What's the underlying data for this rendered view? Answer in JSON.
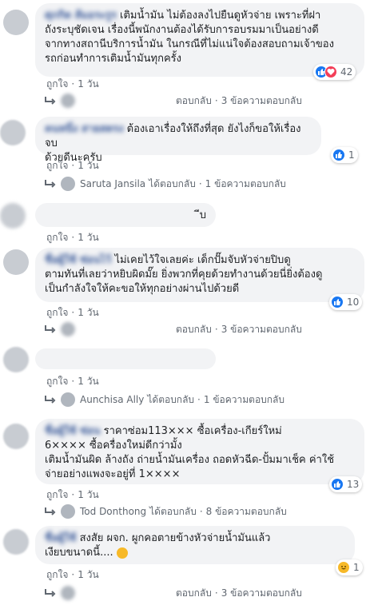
{
  "comments": [
    {
      "author": "ศุภกิต ส้มอระรูร",
      "text": "เติมน้ำมัน ไม่ต้องลงไปยืนดูหัวจ่าย เพราะที่ฝาถังระบุชัดเจน เรื่องนี้พนักงานต้องได้รับการอบรมมาเป็นอย่างดีจากทางสถานีบริการน้ำมัน ในกรณีที่ไม่แน่ใจต้องสอบถามเจ้าของรถก่อนทำการเติมน้ำมันทุกครั้ง",
      "lines": [
        "เติมน้ำมัน ไม่ต้องลงไปยืนดูหัวจ่าย เพราะที่ฝา",
        "ถังระบุชัดเจน เรื่องนี้พนักงานต้องได้รับการอบรมมาเป็นอย่างดี",
        "จากทางสถานีบริการน้ำมัน ในกรณีที่ไม่แน่ใจต้องสอบถามเจ้าของ",
        "รถก่อนทำการเติมน้ำมันทุกครั้ง"
      ],
      "like_label": "ถูกใจ",
      "time": "1 วัน",
      "reaction_count": "42",
      "reply_author": "ตอบกลับ",
      "reply_count": "3 ข้อความตอบกลับ"
    },
    {
      "author": "คนหนึ่ง สายสตรง",
      "lines": [
        "ต้องเอาเรื่องให้ถึงที่สุด ยังไงก็ขอให้เรื่องจบ",
        "ด้วยดีนะครับ"
      ],
      "like_label": "ถูกใจ",
      "time": "1 วัน",
      "reaction_count": "1",
      "reply_author": "Saruta Jansila",
      "reply_verb": "ได้ตอบกลับ",
      "reply_count": "1 ข้อความตอบกลับ"
    },
    {
      "lines": [
        "ีบ"
      ],
      "like_label": "ถูกใจ",
      "time": "1 วัน"
    },
    {
      "author": "ชื่อผู้ใช้ ซ่อนไว้",
      "lines": [
        "ไม่เคยไว้ใจเลยค่ะ เด็กปั๊มจับหัวจ่ายปิบดู",
        "ตามทันที่เลยว่าหยิบผิดมั๊ย ยิ่งพวกที่คุยด้วยทำงานด้วยนี่ยิ่งต้องดู",
        "เป็นกำลังใจให้คะขอให้ทุกอย่างผ่านไปด้วยดี"
      ],
      "like_label": "ถูกใจ",
      "time": "1 วัน",
      "reaction_count": "10",
      "reply_author": "ตอบกลับ",
      "reply_count": "3 ข้อความตอบกลับ"
    },
    {
      "like_label": "ถูกใจ",
      "time": "1 วัน",
      "reply_author": "Aunchisa Ally",
      "reply_verb": "ได้ตอบกลับ",
      "reply_count": "1 ข้อความตอบกลับ"
    },
    {
      "author": "ชื่อผู้ใช้ ซ่อน",
      "lines": [
        "ราคาซ่อม113××× ซื้อเครื่อง-เกียร์ใหม่",
        "6×××× ซื้อครื่องใหม่ดีกว่ามั้ง",
        "เติมน้ำมันผิด ล้างถัง ถ่ายน้ำมันเครื่อง ถอดหัวฉีด-ปั้มมาเช็ค ค่าใช้",
        "จ่ายอย่างแพงจะอยู่ที่ 1××××"
      ],
      "like_label": "ถูกใจ",
      "time": "1 วัน",
      "reaction_count": "13",
      "reply_author": "Tod Donthong",
      "reply_verb": "ได้ตอบกลับ",
      "reply_count": "8 ข้อความตอบกลับ"
    },
    {
      "author": "ชื่อผู้ใช้",
      "lines": [
        "สงสัย ผจก. ผูกคอตายข้างหัวจ่ายน้ำมันแล้ว",
        "เงียบขนาดนี้...."
      ],
      "like_label": "ถูกใจ",
      "time": "1 วัน",
      "reaction_count": "1",
      "reply_author": "ตอบกลับ",
      "reply_count": "3 ข้อความตอบกลับ"
    }
  ],
  "colors": {
    "link": "#385898",
    "bubble": "#f2f3f5",
    "meta": "#606770",
    "like": "#1877f2",
    "love": "#f33e58",
    "haha": "#f7b928"
  }
}
